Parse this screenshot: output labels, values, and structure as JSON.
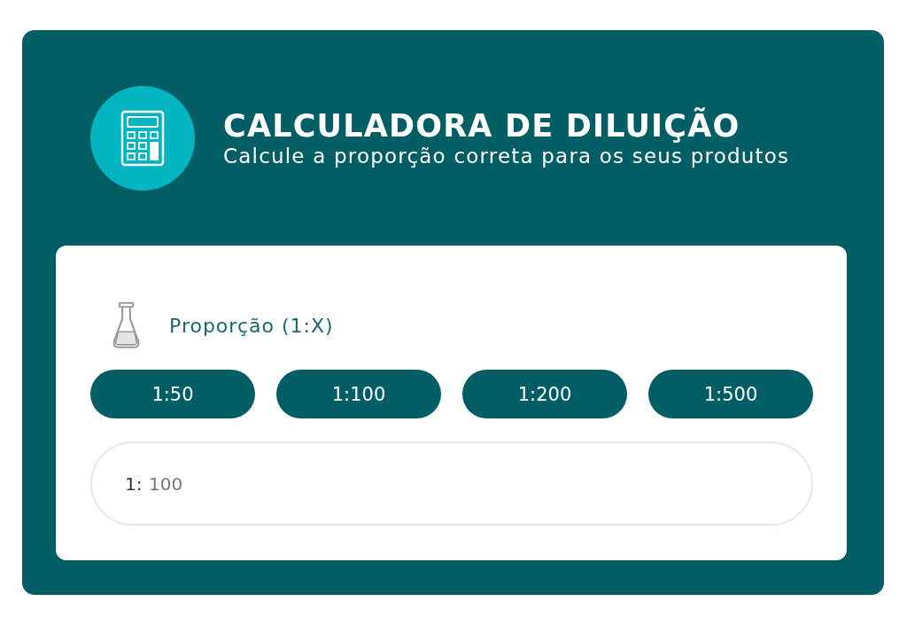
{
  "header": {
    "title": "CALCULADORA DE DILUIÇÃO",
    "subtitle": "Calcule a proporção correta para os seus produtos"
  },
  "ratio_panel": {
    "label": "Proporção (1:X)",
    "presets": [
      {
        "label": "1:50"
      },
      {
        "label": "1:100"
      },
      {
        "label": "1:200"
      },
      {
        "label": "1:500"
      }
    ],
    "input": {
      "prefix": "1:",
      "placeholder": "100"
    }
  }
}
